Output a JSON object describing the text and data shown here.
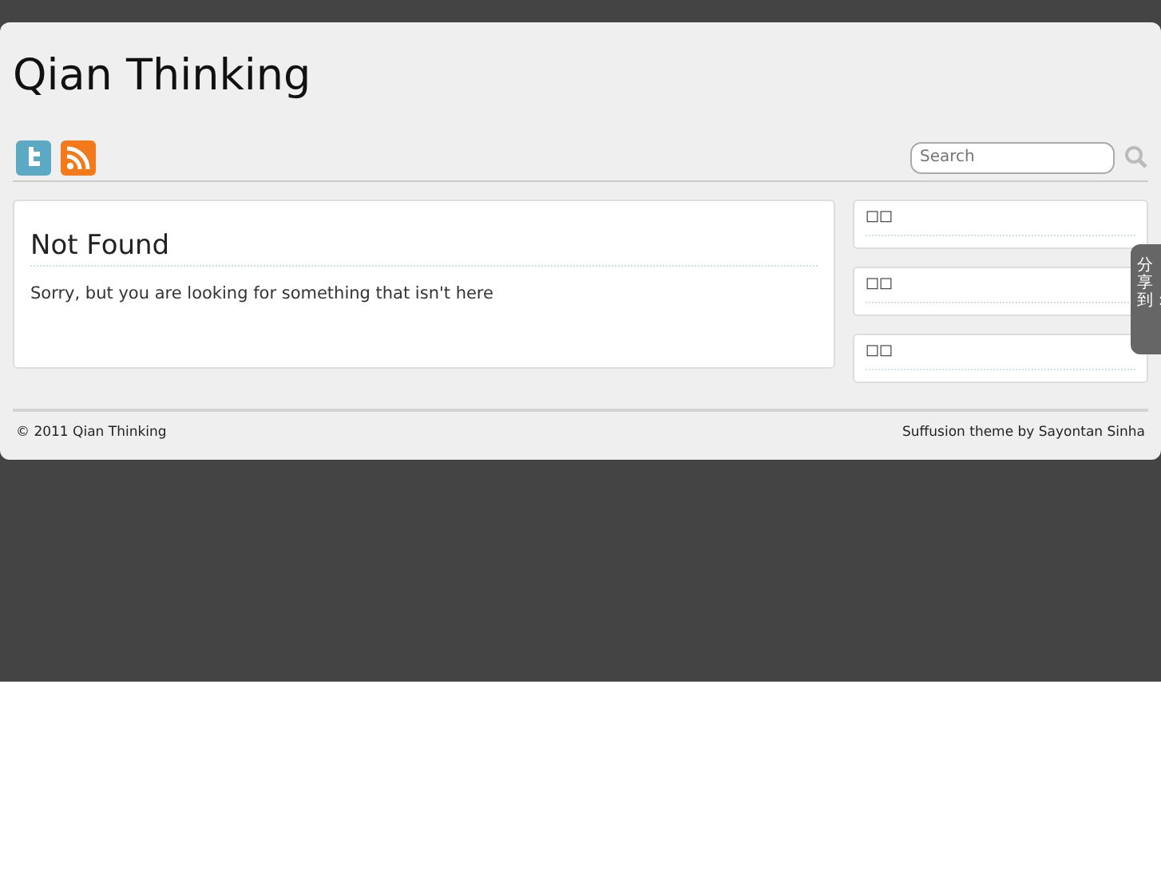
{
  "site_title": "Qian Thinking",
  "social": [
    {
      "kind": "twitter"
    },
    {
      "kind": "rss"
    }
  ],
  "search": {
    "placeholder": "Search"
  },
  "post": {
    "title": "Not Found",
    "text": "Sorry, but you are looking for something that isn't here"
  },
  "widgets": [
    {
      "title": "□□"
    },
    {
      "title": "□□"
    },
    {
      "title": "□□"
    }
  ],
  "share_tab": "分享到：",
  "footer": {
    "left": "© 2011 Qian Thinking",
    "right": "Suffusion theme by Sayontan Sinha"
  }
}
